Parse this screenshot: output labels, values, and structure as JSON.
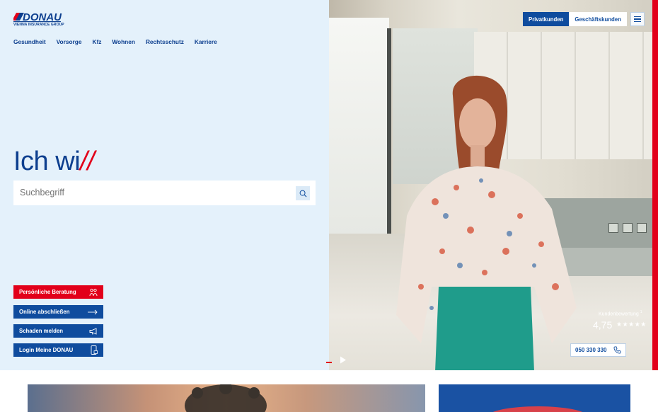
{
  "brand": {
    "logo_text": "DONAU",
    "tagline": "VIENNA INSURANCE GROUP",
    "primary_color": "#0d3f8f",
    "accent_color": "#e2001a",
    "panel_color": "#e4f1fb"
  },
  "nav": {
    "items": [
      "Gesundheit",
      "Vorsorge",
      "Kfz",
      "Wohnen",
      "Rechtsschutz",
      "Karriere"
    ]
  },
  "hero": {
    "headline_main": "Ich wi",
    "headline_slashes": "//",
    "search_placeholder": "Suchbegriff"
  },
  "ctas": [
    {
      "label": "Persönliche Beratung",
      "icon": "advisor-icon",
      "style": "red"
    },
    {
      "label": "Online abschließen",
      "icon": "arrow-right-icon",
      "style": "blue"
    },
    {
      "label": "Schaden melden",
      "icon": "megaphone-icon",
      "style": "blue"
    },
    {
      "label": "Login Meine DONAU",
      "icon": "mobile-lock-icon",
      "style": "blue"
    }
  ],
  "segments": {
    "private": "Privatkunden",
    "business": "Geschäftskunden",
    "active": "Privatkunden"
  },
  "rating": {
    "label": "Kundenbewertung",
    "footnote": "1",
    "value": "4,75",
    "stars": "★★★★★"
  },
  "phone": {
    "number": "050 330 330",
    "icon": "phone-icon"
  },
  "video": {
    "play_icon": "play-icon"
  }
}
